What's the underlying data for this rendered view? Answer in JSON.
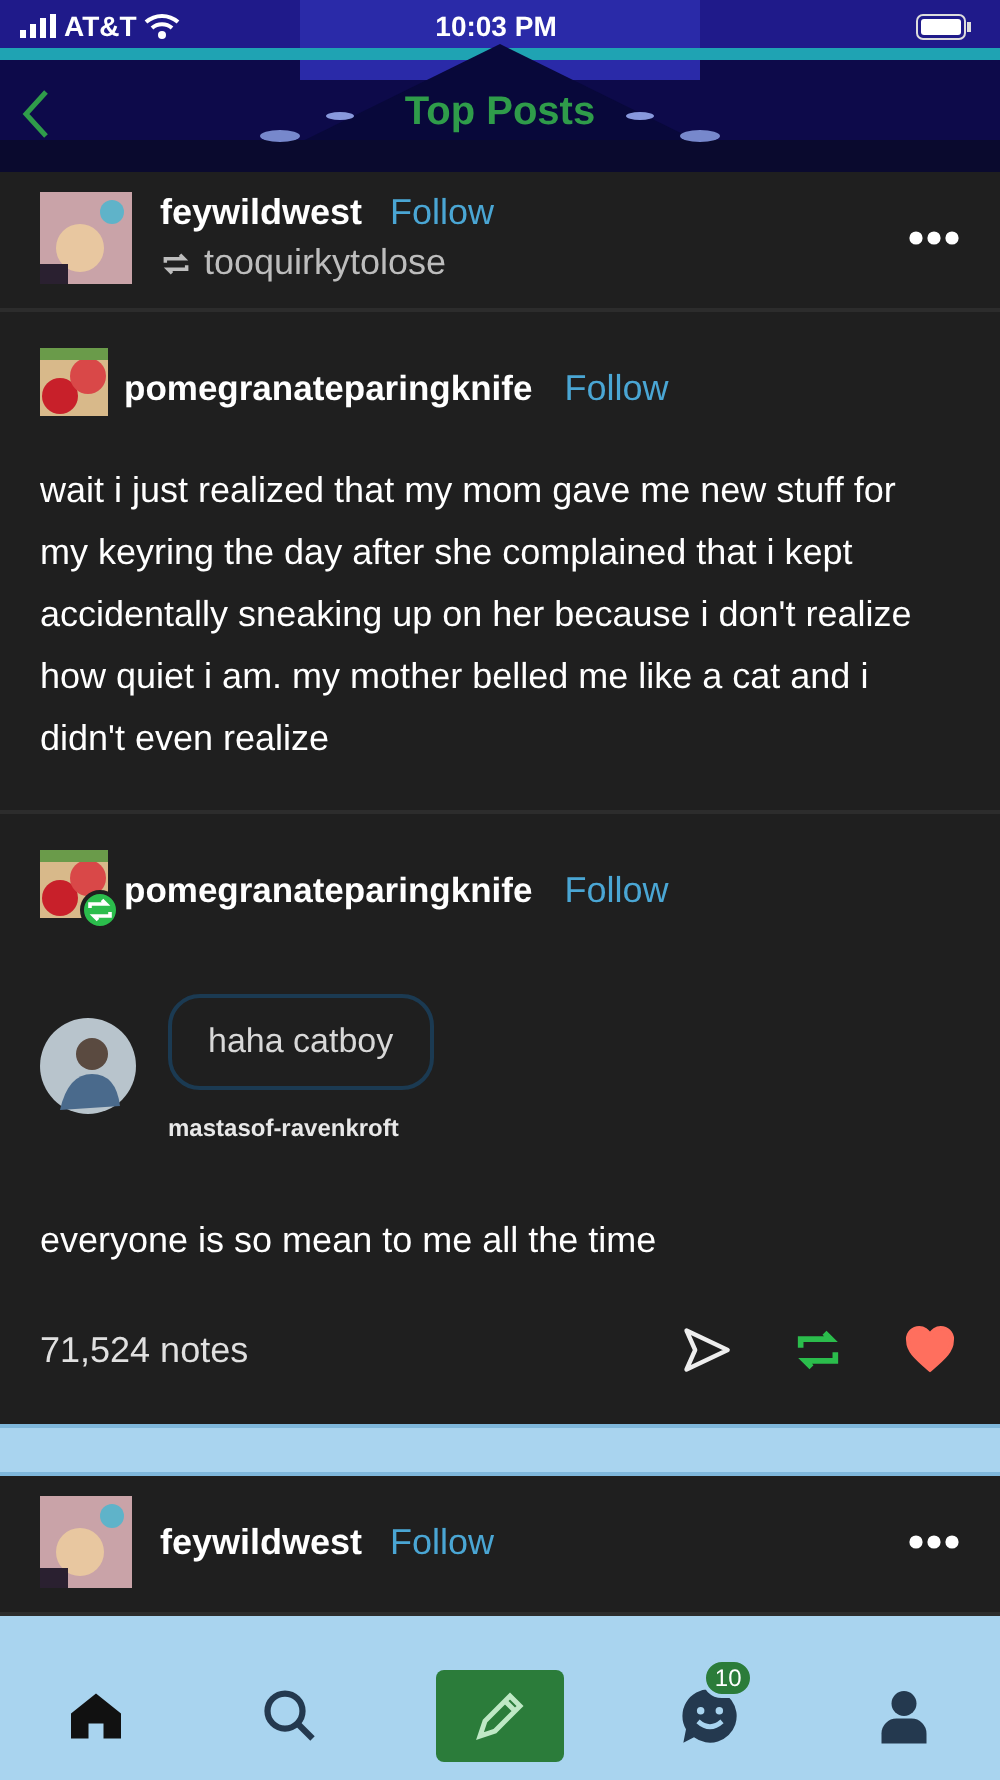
{
  "status_bar": {
    "carrier": "AT&T",
    "time": "10:03 PM"
  },
  "header": {
    "title": "Top Posts"
  },
  "post": {
    "blog": "feywildwest",
    "follow": "Follow",
    "reblogged_from": "tooquirkytolose",
    "trail": [
      {
        "kind": "text",
        "blog": "pomegranateparingknife",
        "follow": "Follow",
        "reblog_badge": false,
        "body": "wait i just realized that my mom gave me new stuff for my keyring the day after she complained that i kept accidentally sneaking up on her because i don't realize how quiet i am. my mother belled me like a cat and i didn't even realize"
      },
      {
        "kind": "ask",
        "blog": "pomegranateparingknife",
        "follow": "Follow",
        "reblog_badge": true,
        "ask": {
          "message": "haha catboy",
          "asker": "mastasof-ravenkroft"
        },
        "body": "everyone is so mean to me all the time"
      }
    ],
    "notes": "71,524 notes",
    "reblogged": true,
    "liked": true
  },
  "next_post": {
    "blog": "feywildwest",
    "follow": "Follow"
  },
  "tab_bar": {
    "items": [
      {
        "kind": "home",
        "selected": true
      },
      {
        "kind": "search",
        "selected": false
      },
      {
        "kind": "compose",
        "selected": false
      },
      {
        "kind": "activity",
        "selected": false,
        "badge": "10"
      },
      {
        "kind": "account",
        "selected": false
      }
    ]
  }
}
